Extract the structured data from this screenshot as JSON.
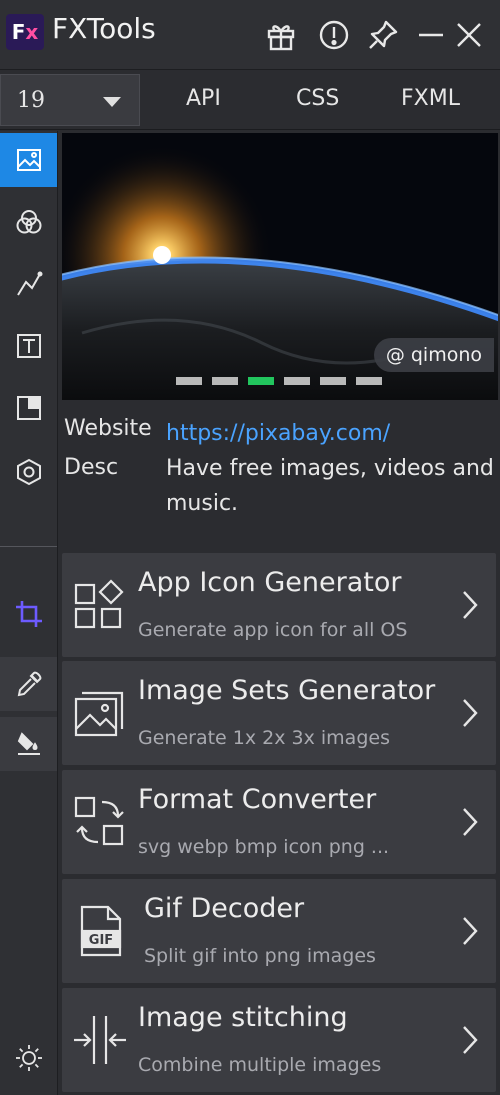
{
  "app": {
    "logo_text": "Fx",
    "title": "FXTools"
  },
  "titlebar_icons": [
    "gift-icon",
    "info-icon",
    "pin-icon",
    "minimize-icon",
    "close-icon"
  ],
  "toolbar": {
    "version_value": "19",
    "tabs": [
      "API",
      "CSS",
      "FXML"
    ]
  },
  "sidebar": {
    "items": [
      "image-icon",
      "color-circles-icon",
      "curve-icon",
      "text-icon",
      "frame-icon",
      "hexagon-icon",
      "crop-icon",
      "eyedropper-icon",
      "paint-bucket-icon",
      "brightness-icon"
    ],
    "active_item": "image-icon",
    "accent": "#1e88e5"
  },
  "banner": {
    "credit": "@ qimono",
    "slides": 6,
    "active_slide": 3
  },
  "info": {
    "website_label": "Website",
    "website_value": "https://pixabay.com/",
    "desc_label": "Desc",
    "desc_value": "Have free images, videos and music."
  },
  "cards": [
    {
      "title": "App Icon Generator",
      "subtitle": "Generate app icon for all OS",
      "icon": "app-grid-icon"
    },
    {
      "title": "Image Sets Generator",
      "subtitle": "Generate 1x 2x 3x images",
      "icon": "image-stack-icon"
    },
    {
      "title": "Format Converter",
      "subtitle": "svg webp bmp icon png ...",
      "icon": "convert-icon"
    },
    {
      "title": "Gif Decoder",
      "subtitle": "Split gif into png images",
      "icon": "gif-file-icon",
      "icon_label": "GIF"
    },
    {
      "title": "Image stitching",
      "subtitle": "Combine multiple images",
      "icon": "stitch-icon"
    }
  ]
}
